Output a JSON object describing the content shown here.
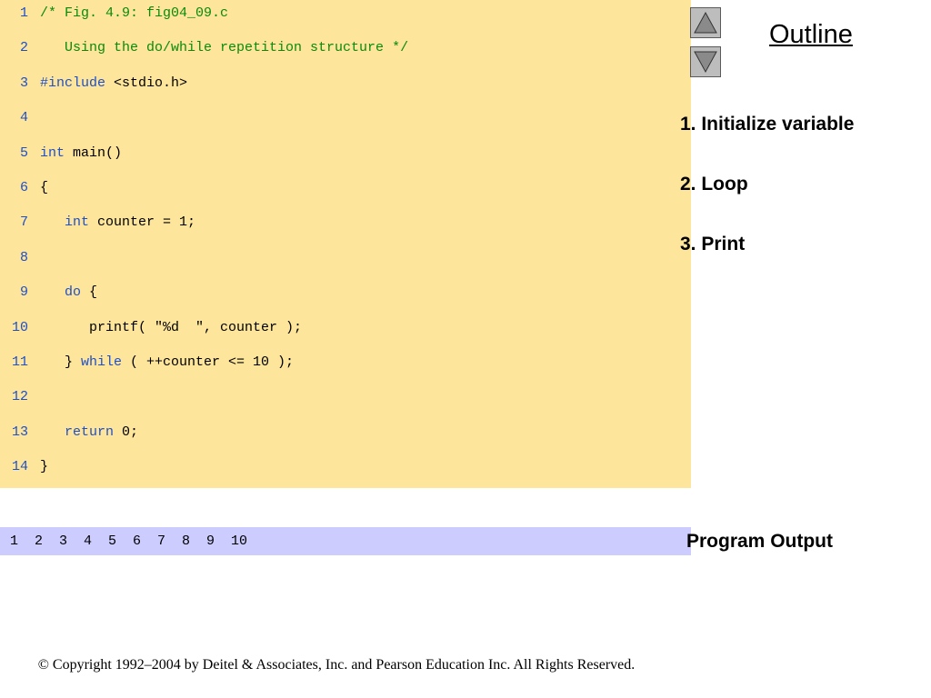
{
  "code_lines": [
    {
      "num": "1",
      "parts": [
        {
          "t": "/* Fig. 4.9: fig04_09.c",
          "c": "cmt"
        }
      ]
    },
    {
      "num": "2",
      "parts": [
        {
          "t": "   Using the do/while repetition structure */",
          "c": "cmt"
        }
      ]
    },
    {
      "num": "3",
      "parts": [
        {
          "t": "#include",
          "c": "kw"
        },
        {
          "t": " <stdio.h>",
          "c": ""
        }
      ]
    },
    {
      "num": "4",
      "parts": []
    },
    {
      "num": "5",
      "parts": [
        {
          "t": "int",
          "c": "kw"
        },
        {
          "t": " main()",
          "c": ""
        }
      ]
    },
    {
      "num": "6",
      "parts": [
        {
          "t": "{",
          "c": ""
        }
      ]
    },
    {
      "num": "7",
      "parts": [
        {
          "t": "   ",
          "c": ""
        },
        {
          "t": "int",
          "c": "kw"
        },
        {
          "t": " counter = 1;",
          "c": ""
        }
      ]
    },
    {
      "num": "8",
      "parts": []
    },
    {
      "num": "9",
      "parts": [
        {
          "t": "   ",
          "c": ""
        },
        {
          "t": "do",
          "c": "kw"
        },
        {
          "t": " {",
          "c": ""
        }
      ]
    },
    {
      "num": "10",
      "parts": [
        {
          "t": "      printf( \"%d  \", counter );",
          "c": ""
        }
      ]
    },
    {
      "num": "11",
      "parts": [
        {
          "t": "   } ",
          "c": ""
        },
        {
          "t": "while",
          "c": "kw"
        },
        {
          "t": " ( ++counter <= 10 );",
          "c": ""
        }
      ]
    },
    {
      "num": "12",
      "parts": []
    },
    {
      "num": "13",
      "parts": [
        {
          "t": "   ",
          "c": ""
        },
        {
          "t": "return",
          "c": "kw"
        },
        {
          "t": " 0;",
          "c": ""
        }
      ]
    },
    {
      "num": "14",
      "parts": [
        {
          "t": "}",
          "c": ""
        }
      ]
    }
  ],
  "program_output": "1  2  3  4  5  6  7  8  9  10",
  "outline": {
    "title": "Outline",
    "items": [
      "1. Initialize variable",
      "2. Loop",
      "3. Print"
    ],
    "program_output_label": "Program Output"
  },
  "nav": {
    "up_icon": "triangle-up-icon",
    "down_icon": "triangle-down-icon"
  },
  "footer": "© Copyright 1992–2004 by Deitel & Associates, Inc. and Pearson Education Inc. All Rights Reserved.",
  "colors": {
    "code_bg": "#fde59b",
    "output_bg": "#ccccff",
    "comment": "#0a8a0a",
    "keyword": "#1f4fc7"
  }
}
